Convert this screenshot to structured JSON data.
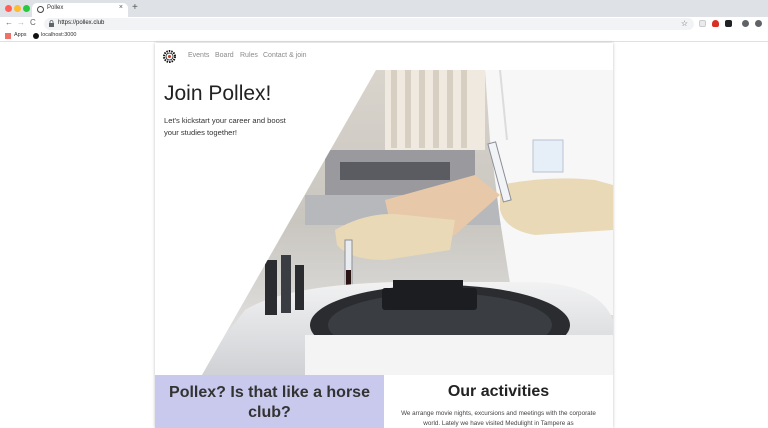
{
  "browser": {
    "tab_title": "Pollex",
    "tab_close": "×",
    "new_tab": "+",
    "url": "https://pollex.club",
    "back": "←",
    "forward": "→",
    "reload": "C",
    "star": "☆",
    "bookmarks": [
      {
        "label": "Apps"
      },
      {
        "label": "localhost:3000"
      }
    ]
  },
  "site": {
    "nav": [
      "Events",
      "Board",
      "Rules",
      "Contact & join"
    ],
    "hero": {
      "title": "Join Pollex!",
      "subtitle": "Let's kickstart your career and boost your studies together!"
    },
    "sections": {
      "left_title": "Pollex? Is that like a horse club?",
      "right_title": "Our activities",
      "right_text": "We arrange movie nights, excursions and meetings with the corporate world. Lately we have visited Medulight in Tampere as"
    }
  },
  "colors": {
    "band_left": "#c8c9ec",
    "chrome_bg": "#dee1e6"
  }
}
